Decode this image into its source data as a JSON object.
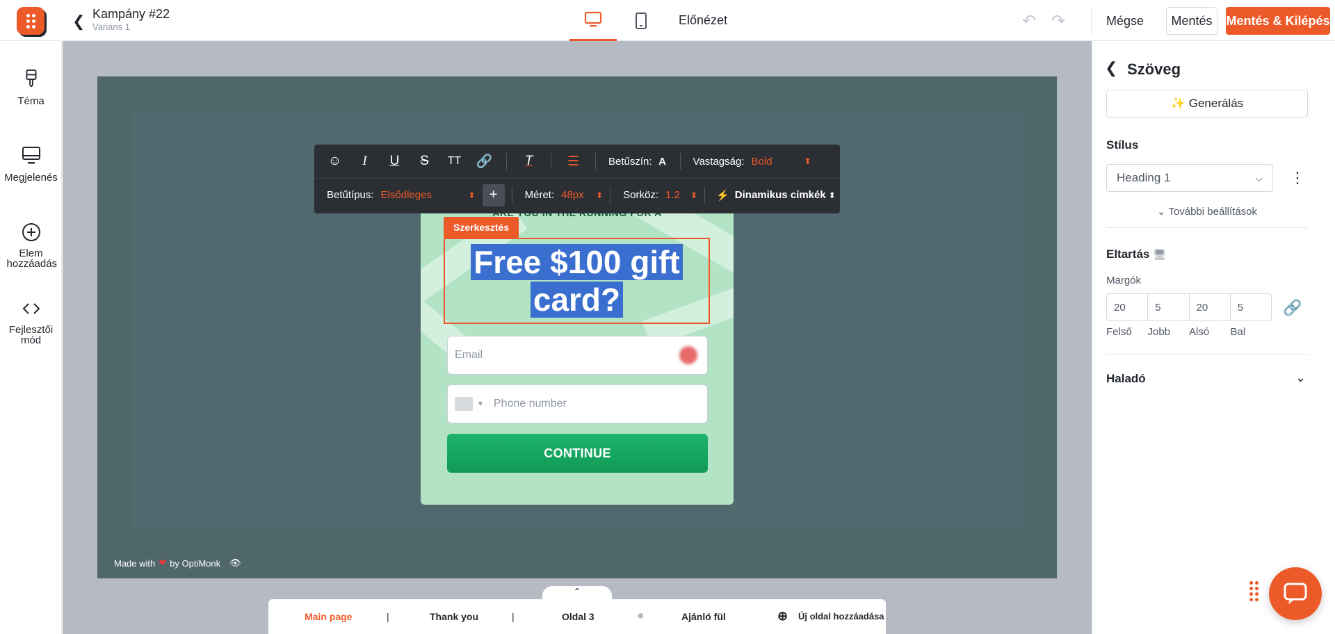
{
  "header": {
    "campaign_title": "Kampány #22",
    "variant": "Variáns 1",
    "preview_label": "Előnézet",
    "cancel_label": "Mégse",
    "save_label": "Mentés",
    "save_exit_label": "Mentés & Kilépés"
  },
  "sidebar": {
    "items": [
      {
        "label": "Téma",
        "icon": "brush-icon"
      },
      {
        "label": "Megjelenés",
        "icon": "monitor-icon"
      },
      {
        "label": "Elem hozzáadás",
        "icon": "plus-circle-icon"
      },
      {
        "label": "Fejlesztői mód",
        "icon": "code-icon"
      }
    ]
  },
  "toolbar": {
    "font_color_label": "Betűszín:",
    "weight_label": "Vastagság:",
    "weight_value": "Bold",
    "font_label": "Betűtípus:",
    "font_value": "Elsődleges",
    "size_label": "Méret:",
    "size_value": "48px",
    "line_height_label": "Sorköz:",
    "line_height_value": "1.2",
    "dynamic_tags_label": "Dinamikus címkék"
  },
  "popup": {
    "kicker": "ARE YOU IN THE RUNNING FOR A",
    "edit_badge": "Szerkesztés",
    "headline_line1": "Free $100 gift",
    "headline_line2": "card?",
    "email_placeholder": "Email",
    "phone_placeholder": "Phone number",
    "continue_label": "CONTINUE"
  },
  "branding": {
    "made_with": "Made with",
    "by": "by OptiMonk"
  },
  "pages": {
    "items": [
      "Main page",
      "Thank you",
      "Oldal 3",
      "Ajánló fül"
    ],
    "active": "Main page",
    "add_label": "Új oldal hozzáadása"
  },
  "panel": {
    "title": "Szöveg",
    "generate_label": "Generálás",
    "style_section": "Stílus",
    "style_value": "Heading 1",
    "more_settings": "További beállítások",
    "spacing_section": "Eltartás",
    "margins_label": "Margók",
    "margins": {
      "top": "20",
      "right": "5",
      "bottom": "20",
      "left": "5"
    },
    "margin_labels": {
      "top": "Felső",
      "right": "Jobb",
      "bottom": "Alsó",
      "left": "Bal"
    },
    "advanced_section": "Haladó"
  },
  "colors": {
    "accent": "#ed5a29",
    "stage_bg": "#4f676b",
    "popup_bg": "#b2e3c5",
    "continue_green": "#1fb36b",
    "selection_blue": "#3a6fd0"
  }
}
